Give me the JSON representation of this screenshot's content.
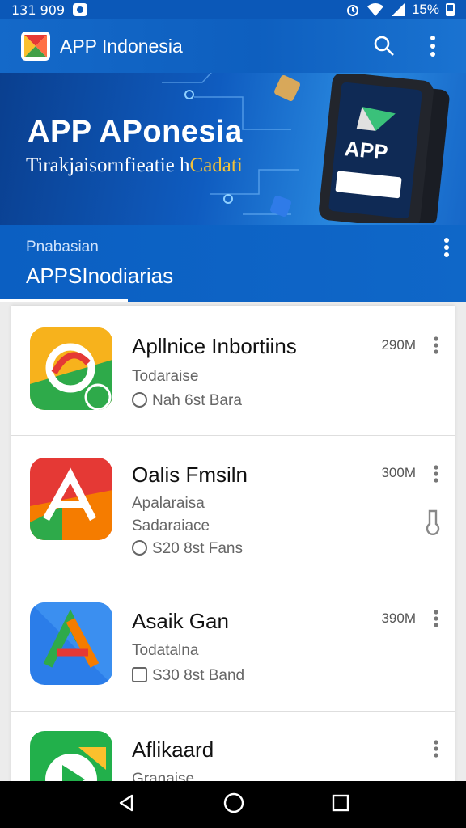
{
  "status_bar": {
    "time": "131 909",
    "battery": "15%"
  },
  "app_bar": {
    "title": "APP Indonesia",
    "icons": [
      "app-logo",
      "search-icon",
      "more-vert-icon"
    ]
  },
  "banner": {
    "title": "APP APonesia",
    "subtitle_main": "Tirakjaisornfieatie h",
    "subtitle_accent": "Cadati",
    "phone_label": "APP"
  },
  "section": {
    "label": "Pnabasian",
    "title": "APPSInodiarias"
  },
  "apps": [
    {
      "name": "Apllnice Inbortiins",
      "line1": "Todaraise",
      "line2": "",
      "detail": "Nah 6st Bara",
      "size": "290M"
    },
    {
      "name": "Oalis Fmsiln",
      "line1": "Apalaraisa",
      "line2": "Sadaraiace",
      "detail": "S20 8st Fans",
      "size": "300M"
    },
    {
      "name": "Asaik Gan",
      "line1": "Todatalna",
      "line2": "",
      "detail": "S30 8st Band",
      "size": "390M"
    },
    {
      "name": "Aflikaard",
      "line1": "Granaise",
      "line2": "",
      "detail": "",
      "size": ""
    }
  ],
  "colors": {
    "primary": "#0f62c4",
    "accent": "#f3c23a",
    "nav": "#000000"
  },
  "nav": {
    "icons": [
      "back-icon",
      "home-icon",
      "recents-icon"
    ]
  }
}
